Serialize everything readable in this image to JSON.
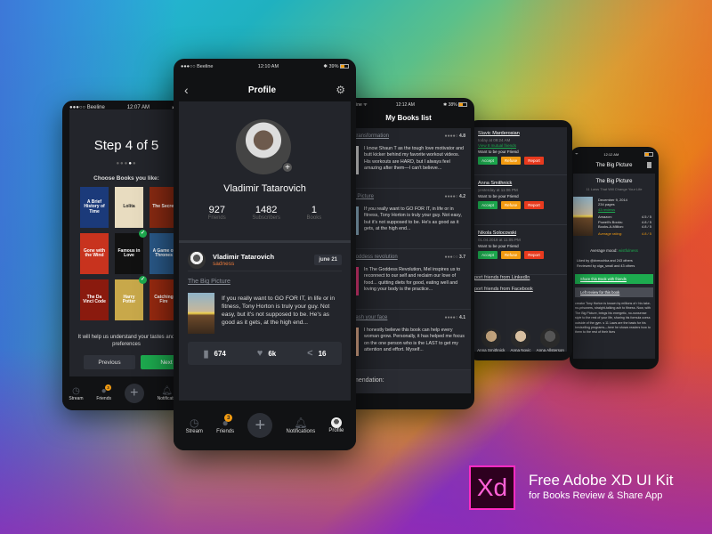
{
  "status": {
    "carrier": "●●●○○ Beeline",
    "time_profile": "12:10 AM",
    "time_step": "12:07 AM",
    "time_books": "12:12 AM",
    "battery": "39%",
    "battery_books": "38%"
  },
  "onboarding": {
    "step": "Step 4 of 5",
    "choose": "Choose Books you like:",
    "books": [
      {
        "title": "A Brief History of Time",
        "color": "#1b3a7a",
        "selected": false
      },
      {
        "title": "Lolita",
        "color": "#e8dcc0",
        "selected": false
      },
      {
        "title": "The Secret",
        "color": "#8a2a12",
        "selected": false
      },
      {
        "title": "Gone with the Wind",
        "color": "#c8331e",
        "selected": false
      },
      {
        "title": "Famous in Love",
        "color": "#111111",
        "selected": true
      },
      {
        "title": "A Game of Thrones",
        "color": "#2a5a8a",
        "selected": false
      },
      {
        "title": "The Da Vinci Code",
        "color": "#8a1a0e",
        "selected": false
      },
      {
        "title": "Harry Potter",
        "color": "#c8a84a",
        "selected": true
      },
      {
        "title": "Catching Fire",
        "color": "#9a2a10",
        "selected": false
      }
    ],
    "help": "It will help us understand your tastes and preferences",
    "previous": "Previous",
    "next": "Next"
  },
  "profile": {
    "title": "Profile",
    "name": "Vladimir Tatarovich",
    "stats": [
      {
        "value": "927",
        "label": "Friends"
      },
      {
        "value": "1482",
        "label": "Subscribers"
      },
      {
        "value": "1",
        "label": "Books"
      }
    ],
    "post": {
      "author": "Vladimir Tatarovich",
      "mood": "sadness",
      "date": "june 21",
      "book_title": "The Big Picture",
      "text": "If you really want to GO FOR IT, in life or in fitness, Tony Horton is truly your guy. Not easy, but it's not supposed to be. He's as good as it gets, at the high end...",
      "bookmarks": "674",
      "likes": "6k",
      "shares": "16"
    }
  },
  "tabbar": {
    "stream": "Stream",
    "friends": "Friends",
    "friends_badge": "3",
    "notifications": "Notifications",
    "notifications_short": "Notificatio",
    "profile": "Profile"
  },
  "books_list": {
    "title": "My Books list",
    "entries": [
      {
        "title": "r transformation",
        "rating": "4.8",
        "stars": "●●●●○",
        "cover": "#ddd",
        "text": "I know Shaun T as the tough love motivator and butt kicker behind my favorite workout videos. His workouts are HARD, but I always feel amazing after them—I can't believe..."
      },
      {
        "title": "ig Picture",
        "rating": "4.2",
        "stars": "●●●●○",
        "cover": "#8fb3c8",
        "text": "If you really want to GO FOR IT, in life or in fitness, Tony Horton is truly your guy. Not easy, but it's not supposed to be. He's as good as it gets, at the high end..."
      },
      {
        "title": "Goddess revolution",
        "rating": "3.7",
        "stars": "●●●○○",
        "cover": "#e83a7a",
        "text": "In The Goddess Revolution, Mel inspires us to reconnect to our self and reclaim our love of food... quitting diets for good, eating well and loving your body is the practice..."
      },
      {
        "title": "wash your face",
        "rating": "4.1",
        "stars": "●●●●○",
        "cover": "#e8b090",
        "text": "I honestly believe this book can help every woman grow. Personally, it has helped me focus on the one person who is the LAST to get my attention and effort. Myself..."
      }
    ],
    "recommendation": "mendation:"
  },
  "friend_requests": {
    "requests": [
      {
        "name": "Slavic Marderosian",
        "time": "today at 09:24 AM",
        "mutual": "View 8 mutual friends",
        "message": "Want to be your Friend"
      },
      {
        "name": "Anna Smithnick",
        "time": "yesterday at 11:06 PM",
        "mutual": "",
        "message": "Want to be your Friend"
      },
      {
        "name": "Nikola Solocovski",
        "time": "01.04.2018 at 11:05 PM",
        "mutual": "",
        "message": "Want to be your Friend"
      }
    ],
    "accept": "Accept",
    "refuse": "Refuse",
    "report": "Report",
    "import_linkedin": "port friends from LinkedIn",
    "import_facebook": "port friends from Facebook",
    "suggested": [
      {
        "name": "Anna Smithnick",
        "label": "nna\nithnick"
      },
      {
        "name": "Anna Novic",
        "label": "Anna\nNovic"
      },
      {
        "name": "Anna Allsterson",
        "label": "Anna\nAllsterson"
      }
    ]
  },
  "book_detail": {
    "title": "The Big Picture",
    "heading": "The Big Picture",
    "subtitle": "11 Laws That Will Change Your Life",
    "date": "December 9, 2014",
    "pages": "234 pages",
    "reviews": "43 reviews",
    "ratings": [
      {
        "source": "Amazon:",
        "value": "4.5 / 5"
      },
      {
        "source": "Powell's Books:",
        "value": "4.8 / 5"
      },
      {
        "source": "Books-A-Million:",
        "value": "4.8 / 5"
      }
    ],
    "average_label": "Average rating:",
    "average_value": "4.8 / 5",
    "mood_label": "Average mood:",
    "mood_value": "wistfulness",
    "liked_by": "Liked by @dvmochka and 243 others",
    "reviewed_by": "Reviewed by olga_small and 43 others",
    "share": "Share this Book with friends",
    "leave_review": "Left review for this book",
    "description": "creator Tony Horton is known by millions of r his take-no-prisoners, straight-talking ach to fitness. Now, with The Big Picture, brings his energetic, no-nonsense style to the rest of your life, sharing his formula ccess outside of the gym. s 11 Laws are the basis for his bestselling programs—here he shows readers how to them to the rest of their lives"
  },
  "branding": {
    "logo": "Xd",
    "line1": "Free Adobe XD UI Kit",
    "line2": "for Books Review & Share App"
  },
  "colors": {
    "accent_green": "#1dab4f",
    "accent_orange": "#f39c12",
    "danger_red": "#e83a1e",
    "mood_orange": "#e8793a",
    "screen_bg": "#23252b"
  }
}
